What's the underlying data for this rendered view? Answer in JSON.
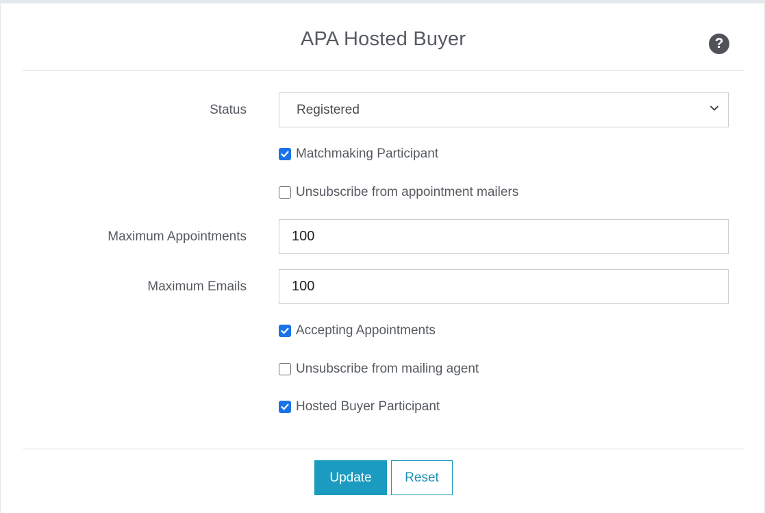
{
  "form": {
    "title": "APA Hosted Buyer",
    "help_icon": "question-circle-icon",
    "status": {
      "label": "Status",
      "selected": "Registered"
    },
    "matchmaking": {
      "label": "Matchmaking Participant",
      "checked": true
    },
    "unsubscribe_appointment": {
      "label": "Unsubscribe from appointment mailers",
      "checked": false
    },
    "max_appointments": {
      "label": "Maximum Appointments",
      "value": "100"
    },
    "max_emails": {
      "label": "Maximum Emails",
      "value": "100"
    },
    "accepting_appointments": {
      "label": "Accepting Appointments",
      "checked": true
    },
    "unsubscribe_mailing": {
      "label": "Unsubscribe from mailing agent",
      "checked": false
    },
    "hosted_buyer": {
      "label": "Hosted Buyer Participant",
      "checked": true
    },
    "update_label": "Update",
    "reset_label": "Reset"
  },
  "colors": {
    "primary": "#1a9bbf",
    "checkbox": "#1a73e8",
    "text": "#555a60"
  }
}
